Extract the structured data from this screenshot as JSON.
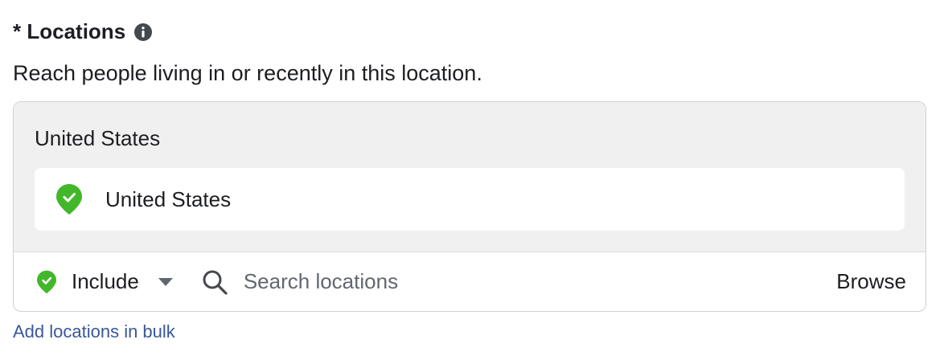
{
  "section": {
    "required_marker": "*",
    "title": "Locations",
    "info_icon": "info-circle-icon",
    "description": "Reach people living in or recently in this location."
  },
  "selected": {
    "group_label": "United States",
    "items": [
      {
        "name": "United States",
        "icon": "location-pin-check-icon",
        "color": "#42b72a"
      }
    ]
  },
  "controls": {
    "mode_label": "Include",
    "mode_icon": "location-pin-check-icon",
    "search_placeholder": "Search locations",
    "search_value": "",
    "browse_label": "Browse"
  },
  "footer": {
    "bulk_link": "Add locations in bulk"
  },
  "colors": {
    "accent_green": "#42b72a",
    "link_blue": "#385898",
    "panel_gray": "#f0f0f0",
    "border": "#ccd0d5"
  }
}
